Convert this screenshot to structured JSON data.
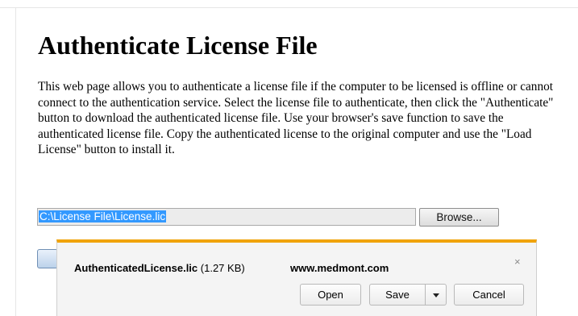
{
  "page": {
    "title": "Authenticate License File",
    "description": "This web page allows you to authenticate a license file if the computer to be licensed is offline or cannot connect to the authentication service. Select the license file to authenticate, then click the \"Authenticate\" button to download the authenticated license file. Use your browser's save function to save the authenticated license file. Copy the authenticated license to the original computer and use the \"Load License\" button to install it."
  },
  "file_picker": {
    "value": "C:\\License File\\License.lic",
    "browse_label": "Browse..."
  },
  "download_bar": {
    "file_name": "AuthenticatedLicense.lic",
    "file_size": "(1.27 KB)",
    "site": "www.medmont.com",
    "close_glyph": "×",
    "open_label": "Open",
    "save_label": "Save",
    "cancel_label": "Cancel",
    "accent_color": "#f0a30a",
    "icons": [
      "close-icon",
      "chevron-down-icon"
    ]
  }
}
